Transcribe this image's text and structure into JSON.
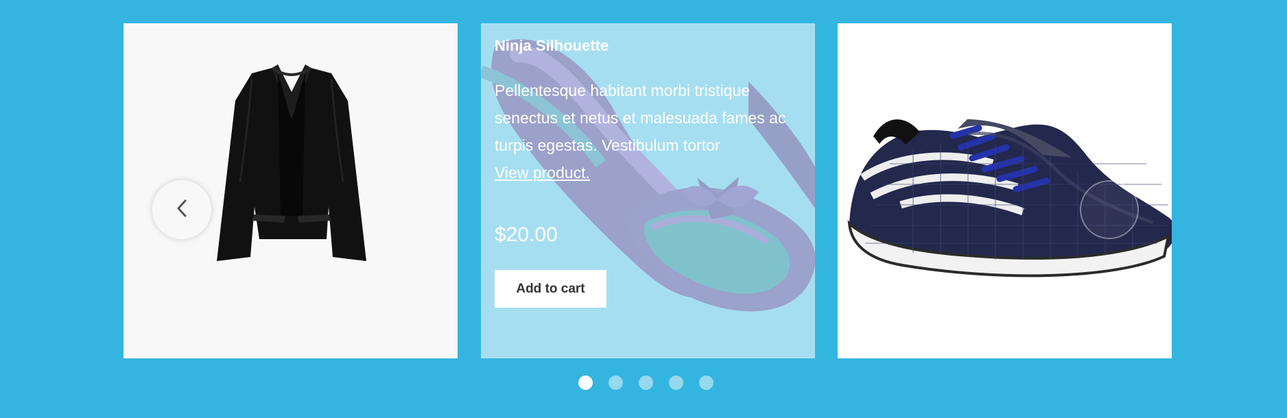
{
  "carousel": {
    "background_color": "#34b5e0",
    "accent_color": "#ffffff",
    "overlay_color": "#a7def1",
    "slides": [
      {
        "image": "black-blazer-image",
        "background": "#f8f8f8"
      },
      {
        "image": "purple-patent-flats-image",
        "title": "Ninja Silhouette",
        "description": "Pellentesque habitant morbi tristique senectus et netus et malesuada fames ac turpis egestas. Vestibulum tortor",
        "link_label": "View product.",
        "price": "$20.00",
        "button_label": "Add to cart"
      },
      {
        "image": "navy-sneaker-image",
        "background": "#ffffff"
      }
    ],
    "nav": {
      "previous_icon": "chevron-left-icon",
      "next_icon": "chevron-right-icon"
    },
    "pagination": {
      "count": 5,
      "active_index": 0
    }
  }
}
